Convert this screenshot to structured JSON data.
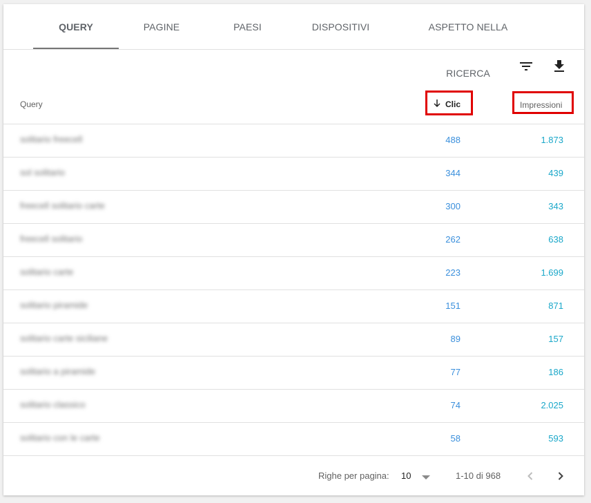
{
  "tabs": [
    {
      "label": "QUERY",
      "active": true
    },
    {
      "label": "PAGINE",
      "active": false
    },
    {
      "label": "PAESI",
      "active": false
    },
    {
      "label": "DISPOSITIVI",
      "active": false
    },
    {
      "label": "ASPETTO NELLA RICERCA",
      "active": false
    }
  ],
  "toolbar": {
    "filter_icon": "filter-icon",
    "download_icon": "download-icon"
  },
  "table": {
    "columns": {
      "query": "Query",
      "clicks": "Clic",
      "impressions": "Impressioni"
    },
    "sort_icon": "arrow-down-icon",
    "rows": [
      {
        "query": "solitario freecell",
        "clicks": "488",
        "impressions": "1.873"
      },
      {
        "query": "sol solitario",
        "clicks": "344",
        "impressions": "439"
      },
      {
        "query": "freecell solitario carte",
        "clicks": "300",
        "impressions": "343"
      },
      {
        "query": "freecell solitario",
        "clicks": "262",
        "impressions": "638"
      },
      {
        "query": "solitario carte",
        "clicks": "223",
        "impressions": "1.699"
      },
      {
        "query": "solitario piramide",
        "clicks": "151",
        "impressions": "871"
      },
      {
        "query": "solitario carte siciliane",
        "clicks": "89",
        "impressions": "157"
      },
      {
        "query": "solitario a piramide",
        "clicks": "77",
        "impressions": "186"
      },
      {
        "query": "solitario classico",
        "clicks": "74",
        "impressions": "2.025"
      },
      {
        "query": "solitario con le carte",
        "clicks": "58",
        "impressions": "593"
      }
    ]
  },
  "footer": {
    "rows_per_page_label": "Righe per pagina:",
    "rows_per_page_value": "10",
    "range_text": "1-10 di 968",
    "prev_icon": "chevron-left-icon",
    "next_icon": "chevron-right-icon"
  },
  "colors": {
    "accent_link": "#3a8fdc",
    "impressions": "#19a7c9",
    "highlight": "#e00000"
  }
}
